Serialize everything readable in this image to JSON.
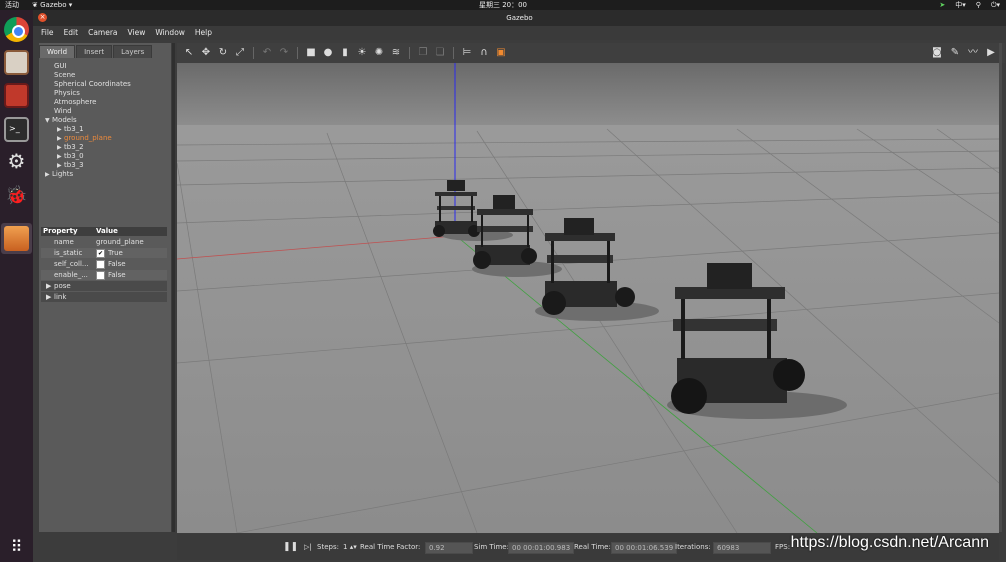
{
  "topbar": {
    "activities": "活动",
    "app_name": "Gazebo",
    "clock": "星期三 20：00",
    "input_method": "中"
  },
  "window": {
    "title": "Gazebo"
  },
  "menu": [
    "File",
    "Edit",
    "Camera",
    "View",
    "Window",
    "Help"
  ],
  "left_panel": {
    "tabs": [
      "World",
      "Insert",
      "Layers"
    ],
    "active_tab": "World",
    "tree": {
      "gui": "GUI",
      "scene": "Scene",
      "spherical": "Spherical Coordinates",
      "physics": "Physics",
      "atmosphere": "Atmosphere",
      "wind": "Wind",
      "models": "Models",
      "model_items": [
        "tb3_1",
        "ground_plane",
        "tb3_2",
        "tb3_0",
        "tb3_3"
      ],
      "selected_model": "ground_plane",
      "lights": "Lights"
    },
    "properties": {
      "header_property": "Property",
      "header_value": "Value",
      "rows": [
        {
          "key": "name",
          "value": "ground_plane"
        },
        {
          "key": "is_static",
          "value": "True",
          "checked": true
        },
        {
          "key": "self_coll...",
          "value": "False",
          "checked": false
        },
        {
          "key": "enable_...",
          "value": "False",
          "checked": false
        }
      ],
      "groups": [
        "pose",
        "link"
      ]
    }
  },
  "bottom": {
    "steps_label": "Steps:",
    "steps_value": "1",
    "rtf_label": "Real Time Factor:",
    "rtf_value": "0.92",
    "sim_time_label": "Sim Time:",
    "sim_time_value": "00 00:01:00.983",
    "real_time_label": "Real Time:",
    "real_time_value": "00 00:01:06.539",
    "iterations_label": "Iterations:",
    "iterations_value": "60983",
    "fps_label": "FPS:"
  },
  "watermark": "https://blog.csdn.net/Arcann",
  "colors": {
    "selected": "#ec8a3c",
    "close": "#e0502a"
  }
}
